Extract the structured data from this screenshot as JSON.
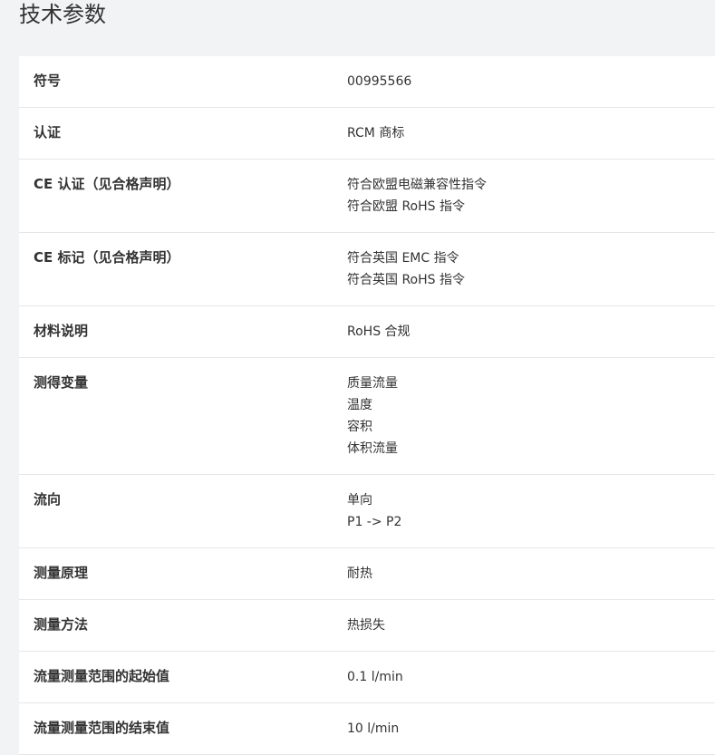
{
  "page": {
    "title": "技术参数"
  },
  "specs": [
    {
      "label": "符号",
      "values": [
        "00995566"
      ]
    },
    {
      "label": "认证",
      "values": [
        "RCM 商标"
      ]
    },
    {
      "label": "CE 认证（见合格声明）",
      "values": [
        "符合欧盟电磁兼容性指令",
        "符合欧盟 RoHS 指令"
      ]
    },
    {
      "label": "CE 标记（见合格声明）",
      "values": [
        "符合英国 EMC 指令",
        "符合英国 RoHS 指令"
      ]
    },
    {
      "label": "材料说明",
      "values": [
        "RoHS 合规"
      ]
    },
    {
      "label": "测得变量",
      "values": [
        "质量流量",
        "温度",
        "容积",
        "体积流量"
      ]
    },
    {
      "label": "流向",
      "values": [
        "单向",
        "P1 -> P2"
      ]
    },
    {
      "label": "测量原理",
      "values": [
        "耐热"
      ]
    },
    {
      "label": "测量方法",
      "values": [
        "热损失"
      ]
    },
    {
      "label": "流量测量范围的起始值",
      "values": [
        "0.1 l/min"
      ]
    },
    {
      "label": "流量测量范围的结束值",
      "values": [
        "10 l/min"
      ]
    }
  ]
}
